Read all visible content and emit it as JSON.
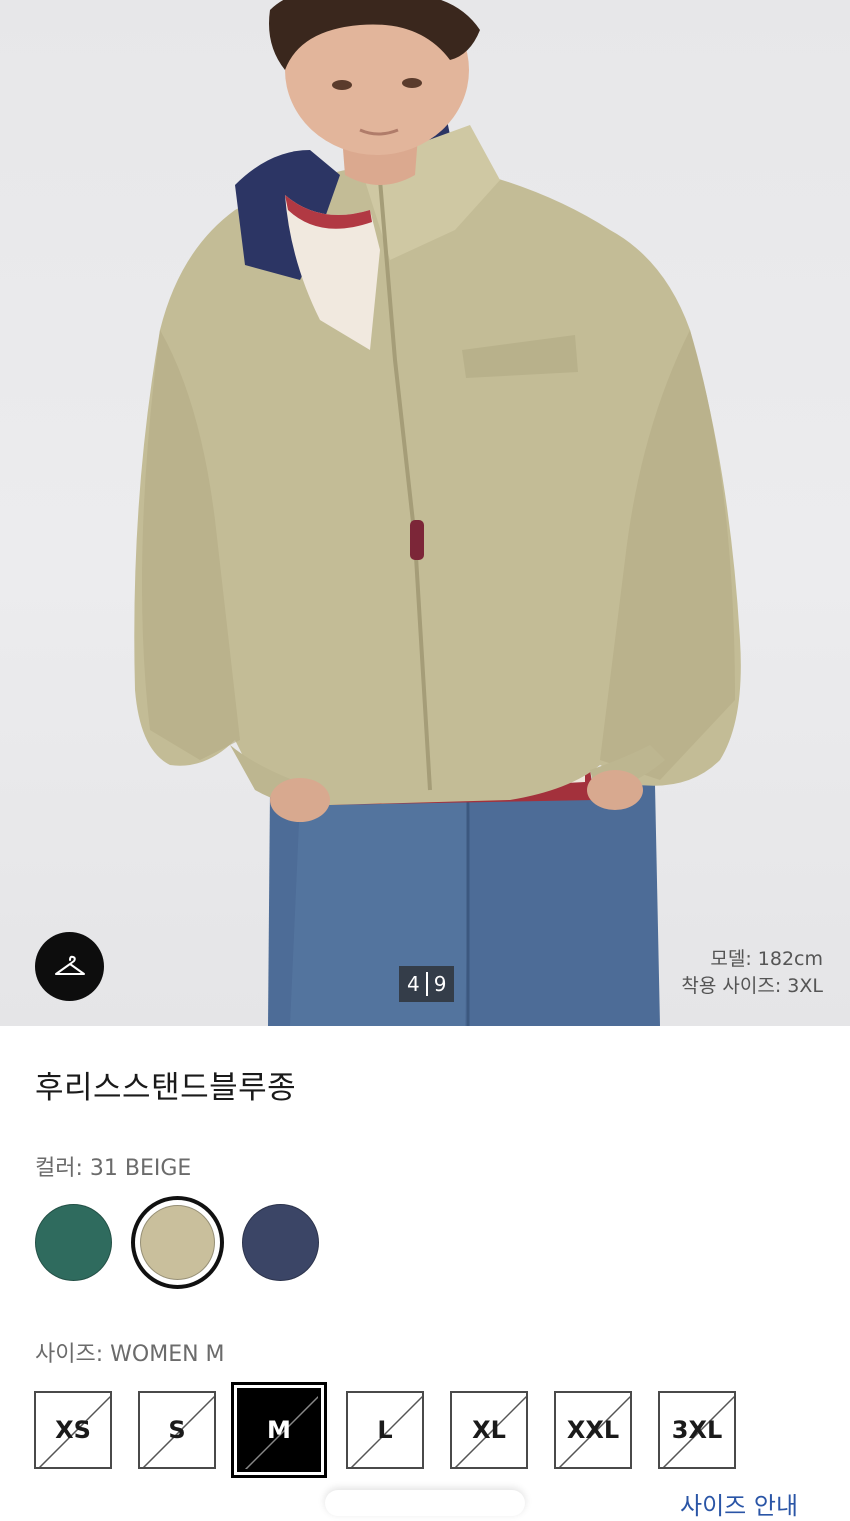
{
  "product": {
    "name": "후리스스탠드블루종",
    "photo_counter": {
      "current": "4",
      "total": "9"
    },
    "model_height": "모델: 182cm",
    "model_size": "착용 사이즈: 3XL",
    "fit_icon": "hanger-icon"
  },
  "color": {
    "label": "컬러: ",
    "selected": "31 BEIGE",
    "options": [
      {
        "name": "green",
        "hex": "#2f6b5e"
      },
      {
        "name": "beige",
        "hex": "#c9bf9c",
        "selected": true
      },
      {
        "name": "navy",
        "hex": "#3b4566"
      }
    ]
  },
  "size": {
    "label": "사이즈: ",
    "selected": "WOMEN M",
    "options": [
      {
        "label": "XS",
        "available": false
      },
      {
        "label": "S",
        "available": false
      },
      {
        "label": "M",
        "available": false,
        "selected": true
      },
      {
        "label": "L",
        "available": false
      },
      {
        "label": "XL",
        "available": false
      },
      {
        "label": "XXL",
        "available": false
      },
      {
        "label": "3XL",
        "available": false
      }
    ],
    "guide_label": "사이즈 안내"
  }
}
